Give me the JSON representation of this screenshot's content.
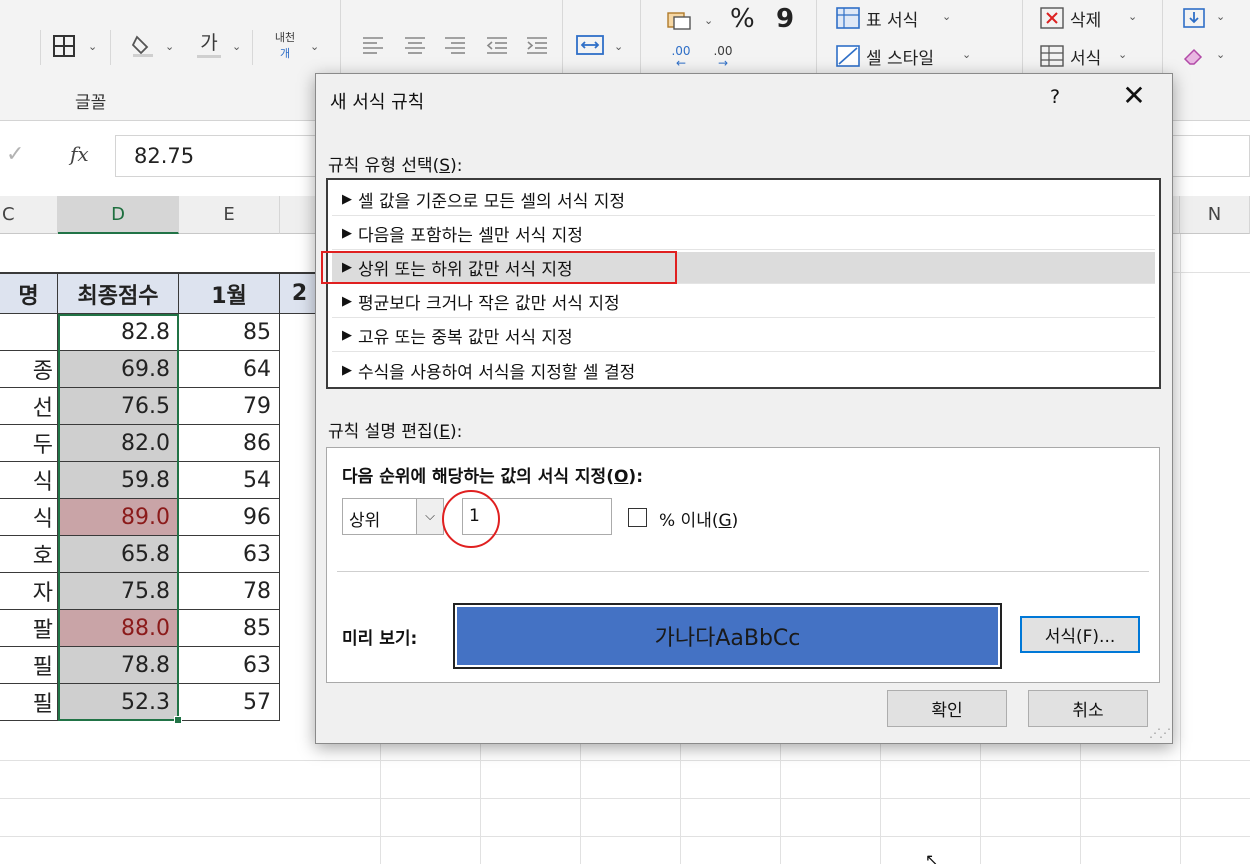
{
  "ribbon": {
    "font_group_label": "글꼴",
    "font_color_glyph": "가",
    "wrap_glyph_top": "내천",
    "wrap_glyph_bottom": "개",
    "percent_glyph": "%",
    "comma_glyph": "9",
    "dec_increase": ".00",
    "dec_decrease": ".00",
    "table_format_label": "표 서식",
    "cell_style_label": "셀 스타일",
    "delete_label": "삭제",
    "format_label": "서식",
    "icons": [
      "borders-icon",
      "fill-color-icon",
      "font-color-icon",
      "wrap-text-icon",
      "align-left-icon",
      "align-center-icon",
      "align-right-icon",
      "decrease-indent-icon",
      "increase-indent-icon",
      "merge-icon",
      "number-format-icon",
      "table-format-icon",
      "cell-style-icon",
      "delete-icon",
      "format-icon",
      "fill-down-icon",
      "clear-icon"
    ]
  },
  "formula_bar": {
    "cancel_glyph": "✓",
    "fx_label": "fx",
    "value": "82.75"
  },
  "grid": {
    "columns": [
      "C",
      "D",
      "E",
      "N"
    ],
    "header": {
      "name": "명",
      "final": "최종점수",
      "jan": "1월",
      "next": "2"
    },
    "rows": [
      {
        "name": "",
        "final": "82.8",
        "jan": "85",
        "highlight": "none"
      },
      {
        "name": "종",
        "final": "69.8",
        "jan": "64",
        "highlight": "gray"
      },
      {
        "name": "선",
        "final": "76.5",
        "jan": "79",
        "highlight": "gray"
      },
      {
        "name": "두",
        "final": "82.0",
        "jan": "86",
        "highlight": "gray"
      },
      {
        "name": "식",
        "final": "59.8",
        "jan": "54",
        "highlight": "gray"
      },
      {
        "name": "식",
        "final": "89.0",
        "jan": "96",
        "highlight": "red"
      },
      {
        "name": "호",
        "final": "65.8",
        "jan": "63",
        "highlight": "gray"
      },
      {
        "name": "자",
        "final": "75.8",
        "jan": "78",
        "highlight": "gray"
      },
      {
        "name": "팔",
        "final": "88.0",
        "jan": "85",
        "highlight": "red"
      },
      {
        "name": "필",
        "final": "78.8",
        "jan": "63",
        "highlight": "gray"
      },
      {
        "name": "필",
        "final": "52.3",
        "jan": "57",
        "highlight": "gray"
      }
    ]
  },
  "dialog": {
    "title": "새 서식 규칙",
    "help": "?",
    "close": "✕",
    "rule_type_label": "규칙 유형 선택(",
    "rule_type_key": "S",
    "rule_type_suffix": "):",
    "rule_types": [
      "셀 값을 기준으로 모든 셀의 서식 지정",
      "다음을 포함하는 셀만 서식 지정",
      "상위 또는 하위 값만 서식 지정",
      "평균보다 크거나 작은 값만 서식 지정",
      "고유 또는 중복 값만 서식 지정",
      "수식을 사용하여 서식을 지정할 셀 결정"
    ],
    "selected_rule_index": 2,
    "edit_label": "규칙 설명 편집(",
    "edit_key": "E",
    "edit_suffix": "):",
    "rank_label": "다음 순위에 해당하는 값의 서식 지정(",
    "rank_key": "O",
    "rank_suffix": "):",
    "rank_select": "상위",
    "rank_value": "1",
    "percent_checked": false,
    "percent_label": "% 이내(",
    "percent_key": "G",
    "percent_suffix": ")",
    "preview_label": "미리 보기:",
    "preview_text": "가나다AaBbCc",
    "preview_fill": "#4472c4",
    "format_button": "서식(F)...",
    "ok_button": "확인",
    "cancel_button": "취소"
  }
}
